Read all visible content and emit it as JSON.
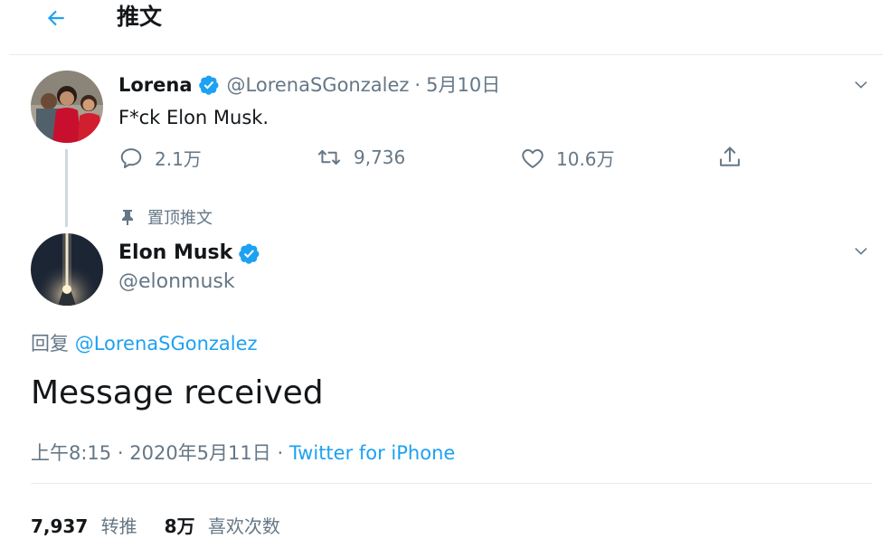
{
  "header": {
    "title": "推文"
  },
  "parent_tweet": {
    "display_name": "Lorena",
    "handle": "@LorenaSGonzalez",
    "dot": "·",
    "date": "5月10日",
    "text": "F*ck Elon Musk.",
    "replies": "2.1万",
    "retweets": "9,736",
    "likes": "10.6万"
  },
  "pinned_label": "置顶推文",
  "main_tweet": {
    "display_name": "Elon Musk",
    "handle": "@elonmusk",
    "reply_prefix": "回复",
    "reply_mention": "@LorenaSGonzalez",
    "text": "Message received",
    "time": "上午8:15",
    "dot1": "·",
    "date": "2020年5月11日",
    "dot2": "·",
    "source": "Twitter for iPhone"
  },
  "stats": {
    "retweets_count": "7,937",
    "retweets_label": "转推",
    "likes_count": "8万",
    "likes_label": "喜欢次数"
  },
  "colors": {
    "accent": "#1da1f2",
    "secondary_text": "#657786",
    "primary_text": "#14171a",
    "divider": "#e6ecf0"
  },
  "icons": {
    "back": "arrow-left-icon",
    "verified": "verified-badge-icon",
    "caret": "chevron-down-icon",
    "reply": "comment-bubble-icon",
    "retweet": "retweet-icon",
    "like": "heart-icon",
    "share": "share-upload-icon",
    "pin": "pin-icon"
  }
}
